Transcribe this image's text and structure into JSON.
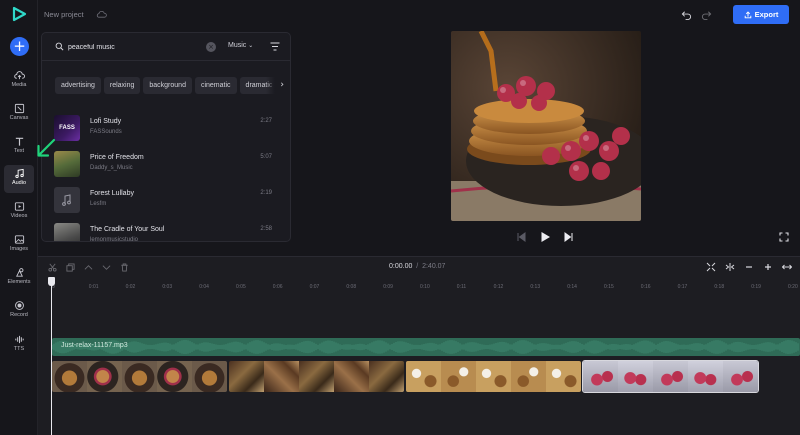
{
  "header": {
    "project_title": "New project",
    "export_label": "Export"
  },
  "rail": {
    "items": [
      {
        "label": "Media",
        "icon": "cloud-upload-icon"
      },
      {
        "label": "Canvas",
        "icon": "canvas-icon"
      },
      {
        "label": "Text",
        "icon": "text-icon"
      },
      {
        "label": "Audio",
        "icon": "music-note-icon"
      },
      {
        "label": "Videos",
        "icon": "video-icon"
      },
      {
        "label": "Images",
        "icon": "image-icon"
      },
      {
        "label": "Elements",
        "icon": "elements-icon"
      },
      {
        "label": "Record",
        "icon": "record-icon"
      },
      {
        "label": "TTS",
        "icon": "tts-icon"
      }
    ],
    "active": "Audio"
  },
  "audio_panel": {
    "search_value": "peaceful music",
    "category": "Music",
    "chips": [
      "advertising",
      "relaxing",
      "background",
      "cinematic",
      "dramatic"
    ],
    "tracks": [
      {
        "title": "Lofi Study",
        "artist": "FASSounds",
        "duration": "2:27",
        "thumb_text": "FASS"
      },
      {
        "title": "Price of Freedom",
        "artist": "Daddy_s_Music",
        "duration": "5:07"
      },
      {
        "title": "Forest Lullaby",
        "artist": "Lesfm",
        "duration": "2:19"
      },
      {
        "title": "The Cradle of Your Soul",
        "artist": "lemonmusicstudio",
        "duration": "2:58"
      }
    ]
  },
  "timeline": {
    "current_time": "0:00.00",
    "separator": "/",
    "total_time": "2:40.07",
    "ruler_labels": [
      "0",
      "0:01",
      "0:02",
      "0:03",
      "0:04",
      "0:05",
      "0:06",
      "0:07",
      "0:08",
      "0:09",
      "0:10",
      "0:11",
      "0:12",
      "0:13",
      "0:14",
      "0:15",
      "0:16",
      "0:17",
      "0:18",
      "0:19",
      "0:20"
    ],
    "audio_clip_name": "Just-relax-11157.mp3"
  },
  "colors": {
    "accent": "#2f6df6",
    "audio_track": "#2f6b57",
    "annotation_arrow": "#1fd37a",
    "background": "#16161b"
  }
}
